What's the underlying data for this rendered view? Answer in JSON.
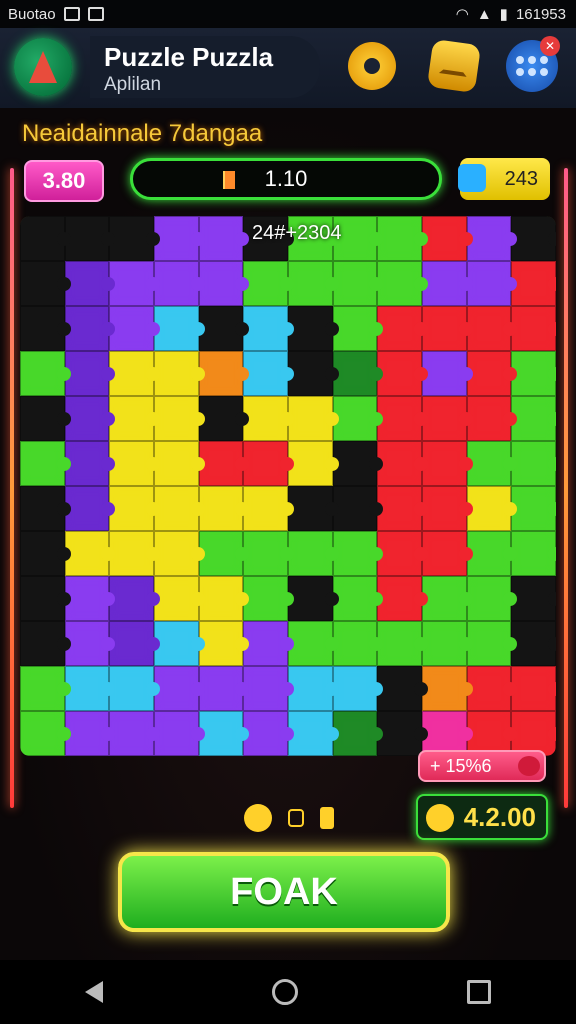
{
  "status_bar": {
    "left_text": "Buotao",
    "right_text": "161953"
  },
  "header": {
    "title": "Puzzle Puzzla",
    "subtitle": "Aplilan",
    "notification_badge": "✕"
  },
  "board": {
    "level_title": "Neaidainnale 7dangaa",
    "score": "3.80",
    "progress_text": "1.10",
    "coins": "243",
    "grid_label": "24#+2304",
    "bonus_text": "+ 15%6",
    "time_value": "4.2.00",
    "colors": {
      "purple": "#8a3cf0",
      "violet": "#6a2ad0",
      "cyan": "#39c8f0",
      "yellow": "#f2e21a",
      "green": "#48d82a",
      "darkgreen": "#1f8a26",
      "red": "#f0242e",
      "pink": "#f030a0",
      "orange": "#f28a1a",
      "dark": "#141414"
    },
    "grid_rows": [
      "dddppdGGGrpd",
      "dvpppGGGGppr",
      "dvpcdcdGrrrr",
      "GvyyocdkrprG",
      "dvyydyyGrrrG",
      "GvyyrrydrrGG",
      "dvyyyyddrryG",
      "dyyyGGGGrrGG",
      "dpvyyGdGrGGd",
      "dpvcypGGGGGd",
      "Gccpppccdorr",
      "Gpppcpckdgrr"
    ]
  },
  "actions": {
    "play_label": "FOAK"
  }
}
